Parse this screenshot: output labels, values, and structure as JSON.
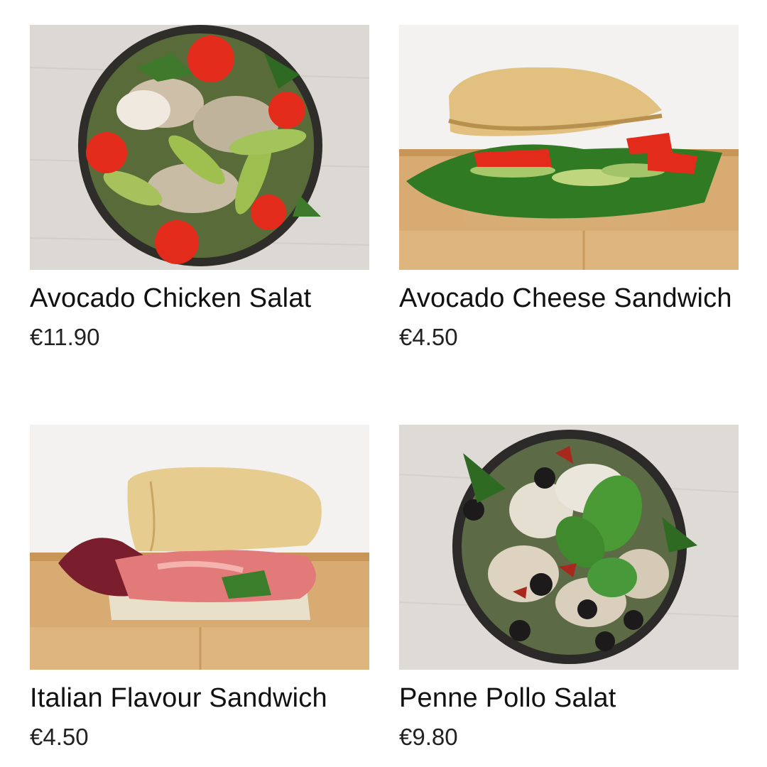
{
  "menu": {
    "items": [
      {
        "name": "Avocado Chicken Salat",
        "price": "€11.90",
        "image_icon": "salad-bowl-image"
      },
      {
        "name": "Avocado Cheese Sandwich",
        "price": "€4.50",
        "image_icon": "sandwich-image"
      },
      {
        "name": "Italian Flavour Sandwich",
        "price": "€4.50",
        "image_icon": "sandwich-image"
      },
      {
        "name": "Penne Pollo Salat",
        "price": "€9.80",
        "image_icon": "salad-bowl-image"
      }
    ]
  },
  "colors": {
    "text": "#111111",
    "background": "#ffffff",
    "wood": "#d9b07a",
    "bread": "#e2c07f",
    "tomato": "#e32b1c",
    "lettuce": "#3f8a2c"
  }
}
